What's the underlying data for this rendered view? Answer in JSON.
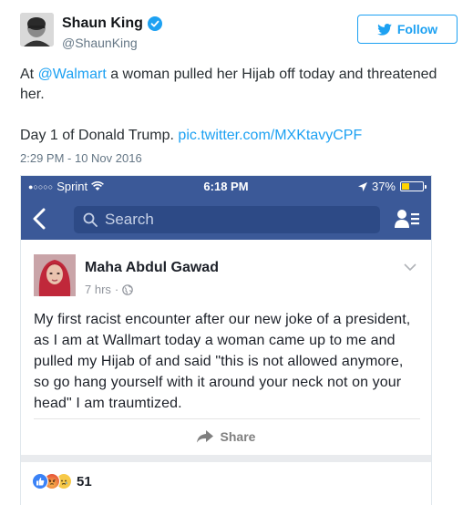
{
  "tweet": {
    "author_name": "Shaun King",
    "handle": "@ShaunKing",
    "follow_label": "Follow",
    "text_prefix": "At ",
    "mention": "@Walmart",
    "text_rest": " a woman pulled her Hijab off today and threatened her.",
    "line2_text": "Day 1 of Donald Trump. ",
    "line2_link": "pic.twitter.com/MXKtavyCPF",
    "timestamp": "2:29 PM - 10 Nov 2016"
  },
  "screenshot": {
    "status_bar": {
      "carrier": "Sprint",
      "signal_dots": "●○○○○",
      "time": "6:18 PM",
      "battery_text": "37%",
      "battery_level": 0.37
    },
    "nav": {
      "search_placeholder": "Search"
    },
    "post": {
      "author": "Maha Abdul Gawad",
      "time_ago": "7 hrs",
      "dot": "·",
      "body": "My first racist encounter after our new joke of a president, as I am at Wallmart today a woman came up to me and pulled my Hijab of and said \"this is not allowed anymore, so go hang yourself with it around your neck not on your head\" I am traumtized.",
      "share_label": "Share",
      "reaction_count": "51"
    }
  },
  "icons": [
    "verified-icon",
    "twitter-bird-icon",
    "back-chevron-icon",
    "search-icon",
    "friend-requests-icon",
    "wifi-icon",
    "location-arrow-icon",
    "globe-icon",
    "chevron-down-icon",
    "share-arrow-icon",
    "like-reaction-icon",
    "angry-reaction-icon",
    "sad-reaction-icon"
  ],
  "colors": {
    "twitter_blue": "#1da1f2",
    "facebook_blue": "#3b5998",
    "battery_yellow": "#ffd400"
  }
}
